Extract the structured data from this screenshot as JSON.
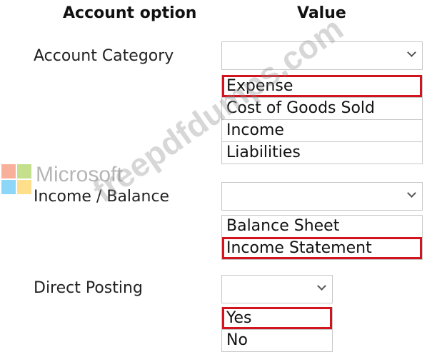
{
  "header": {
    "option_col": "Account option",
    "value_col": "Value"
  },
  "fields": [
    {
      "label": "Account Category",
      "options": [
        "Expense",
        "Cost of Goods Sold",
        "Income",
        "Liabilities"
      ],
      "selected": "Expense"
    },
    {
      "label": "Income / Balance",
      "options": [
        "Balance Sheet",
        "Income Statement"
      ],
      "selected": "Income Statement"
    },
    {
      "label": "Direct Posting",
      "options": [
        "Yes",
        "No"
      ],
      "selected": "Yes"
    }
  ],
  "watermark": {
    "brand": "Microsoft",
    "site": "freepdfdumps.com"
  },
  "colors": {
    "selection_border": "#d3141e",
    "logo": [
      "#f25022",
      "#7fba00",
      "#00a4ef",
      "#ffb900"
    ]
  }
}
